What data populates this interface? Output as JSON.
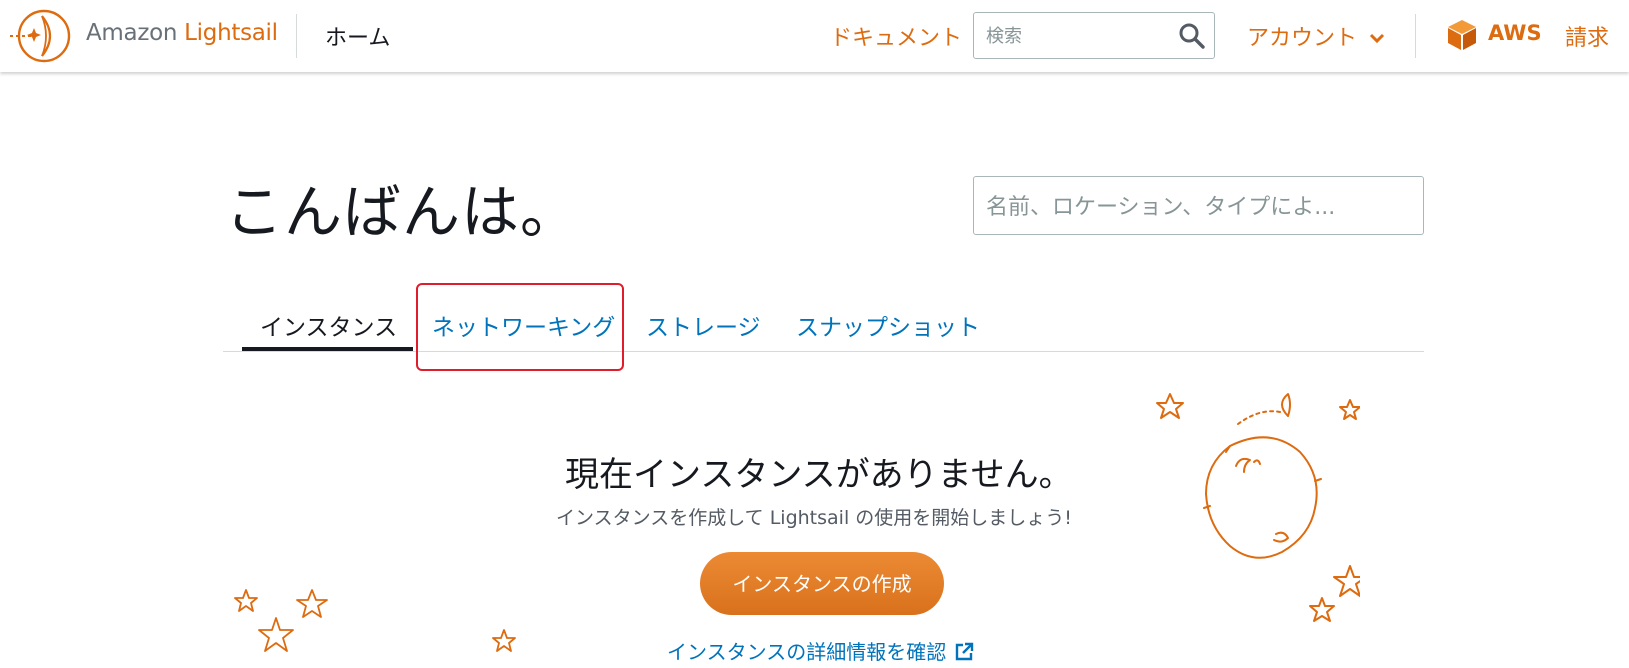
{
  "header": {
    "brand_prefix": "Amazon",
    "brand_name": "Lightsail",
    "home_label": "ホーム",
    "docs_label": "ドキュメント",
    "search_placeholder": "検索",
    "account_label": "アカウント",
    "aws_label": "AWS",
    "billing_label": "請求"
  },
  "main": {
    "greeting": "こんばんは。",
    "filter_placeholder": "名前、ロケーション、タイプによ...",
    "tabs": [
      {
        "label": "インスタンス",
        "active": true
      },
      {
        "label": "ネットワーキング",
        "active": false
      },
      {
        "label": "ストレージ",
        "active": false
      },
      {
        "label": "スナップショット",
        "active": false
      }
    ],
    "empty_title": "現在インスタンスがありません。",
    "empty_subtitle": "インスタンスを作成して Lightsail の使用を開始しましょう!",
    "create_button": "インスタンスの作成",
    "learn_more": "インスタンスの詳細情報を確認"
  },
  "colors": {
    "accent": "#dd6b10",
    "link": "#0073bb",
    "text": "#16191f",
    "highlight": "#e01e2b"
  },
  "icons": [
    "lightsail-logo-icon",
    "search-icon",
    "chevron-down-icon",
    "aws-cube-icon",
    "external-link-icon",
    "star-icon",
    "planet-icon"
  ]
}
